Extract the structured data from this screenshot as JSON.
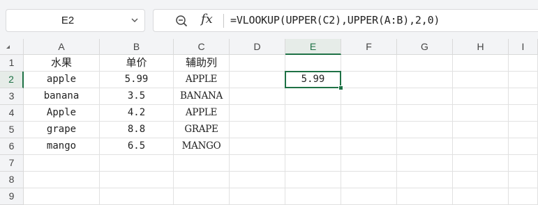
{
  "name_box": {
    "value": "E2"
  },
  "formula_bar": {
    "fx_label": "fx",
    "formula": "=VLOOKUP(UPPER(C2),UPPER(A:B),2,0)"
  },
  "columns": [
    "A",
    "B",
    "C",
    "D",
    "E",
    "F",
    "G",
    "H",
    "I"
  ],
  "active_column": "E",
  "rows": [
    {
      "num": "1",
      "A": "水果",
      "B": "单价",
      "C": "辅助列",
      "E": ""
    },
    {
      "num": "2",
      "A": "apple",
      "B": "5.99",
      "C": "APPLE",
      "E": "5.99"
    },
    {
      "num": "3",
      "A": "banana",
      "B": "3.5",
      "C": "BANANA",
      "E": ""
    },
    {
      "num": "4",
      "A": "Apple",
      "B": "4.2",
      "C": "APPLE",
      "E": ""
    },
    {
      "num": "5",
      "A": "grape",
      "B": "8.8",
      "C": "GRAPE",
      "E": ""
    },
    {
      "num": "6",
      "A": "mango",
      "B": "6.5",
      "C": "MANGO",
      "E": ""
    },
    {
      "num": "7",
      "A": "",
      "B": "",
      "C": "",
      "E": ""
    },
    {
      "num": "8",
      "A": "",
      "B": "",
      "C": "",
      "E": ""
    },
    {
      "num": "9",
      "A": "",
      "B": "",
      "C": "",
      "E": ""
    }
  ],
  "active_row": "2",
  "icons": {
    "name_box_dropdown": "chevron-down-icon",
    "zoom": "zoom-icon",
    "corner": "select-all-icon"
  },
  "colors": {
    "accent": "#1e7145",
    "header_bg": "#f3f4f6"
  }
}
